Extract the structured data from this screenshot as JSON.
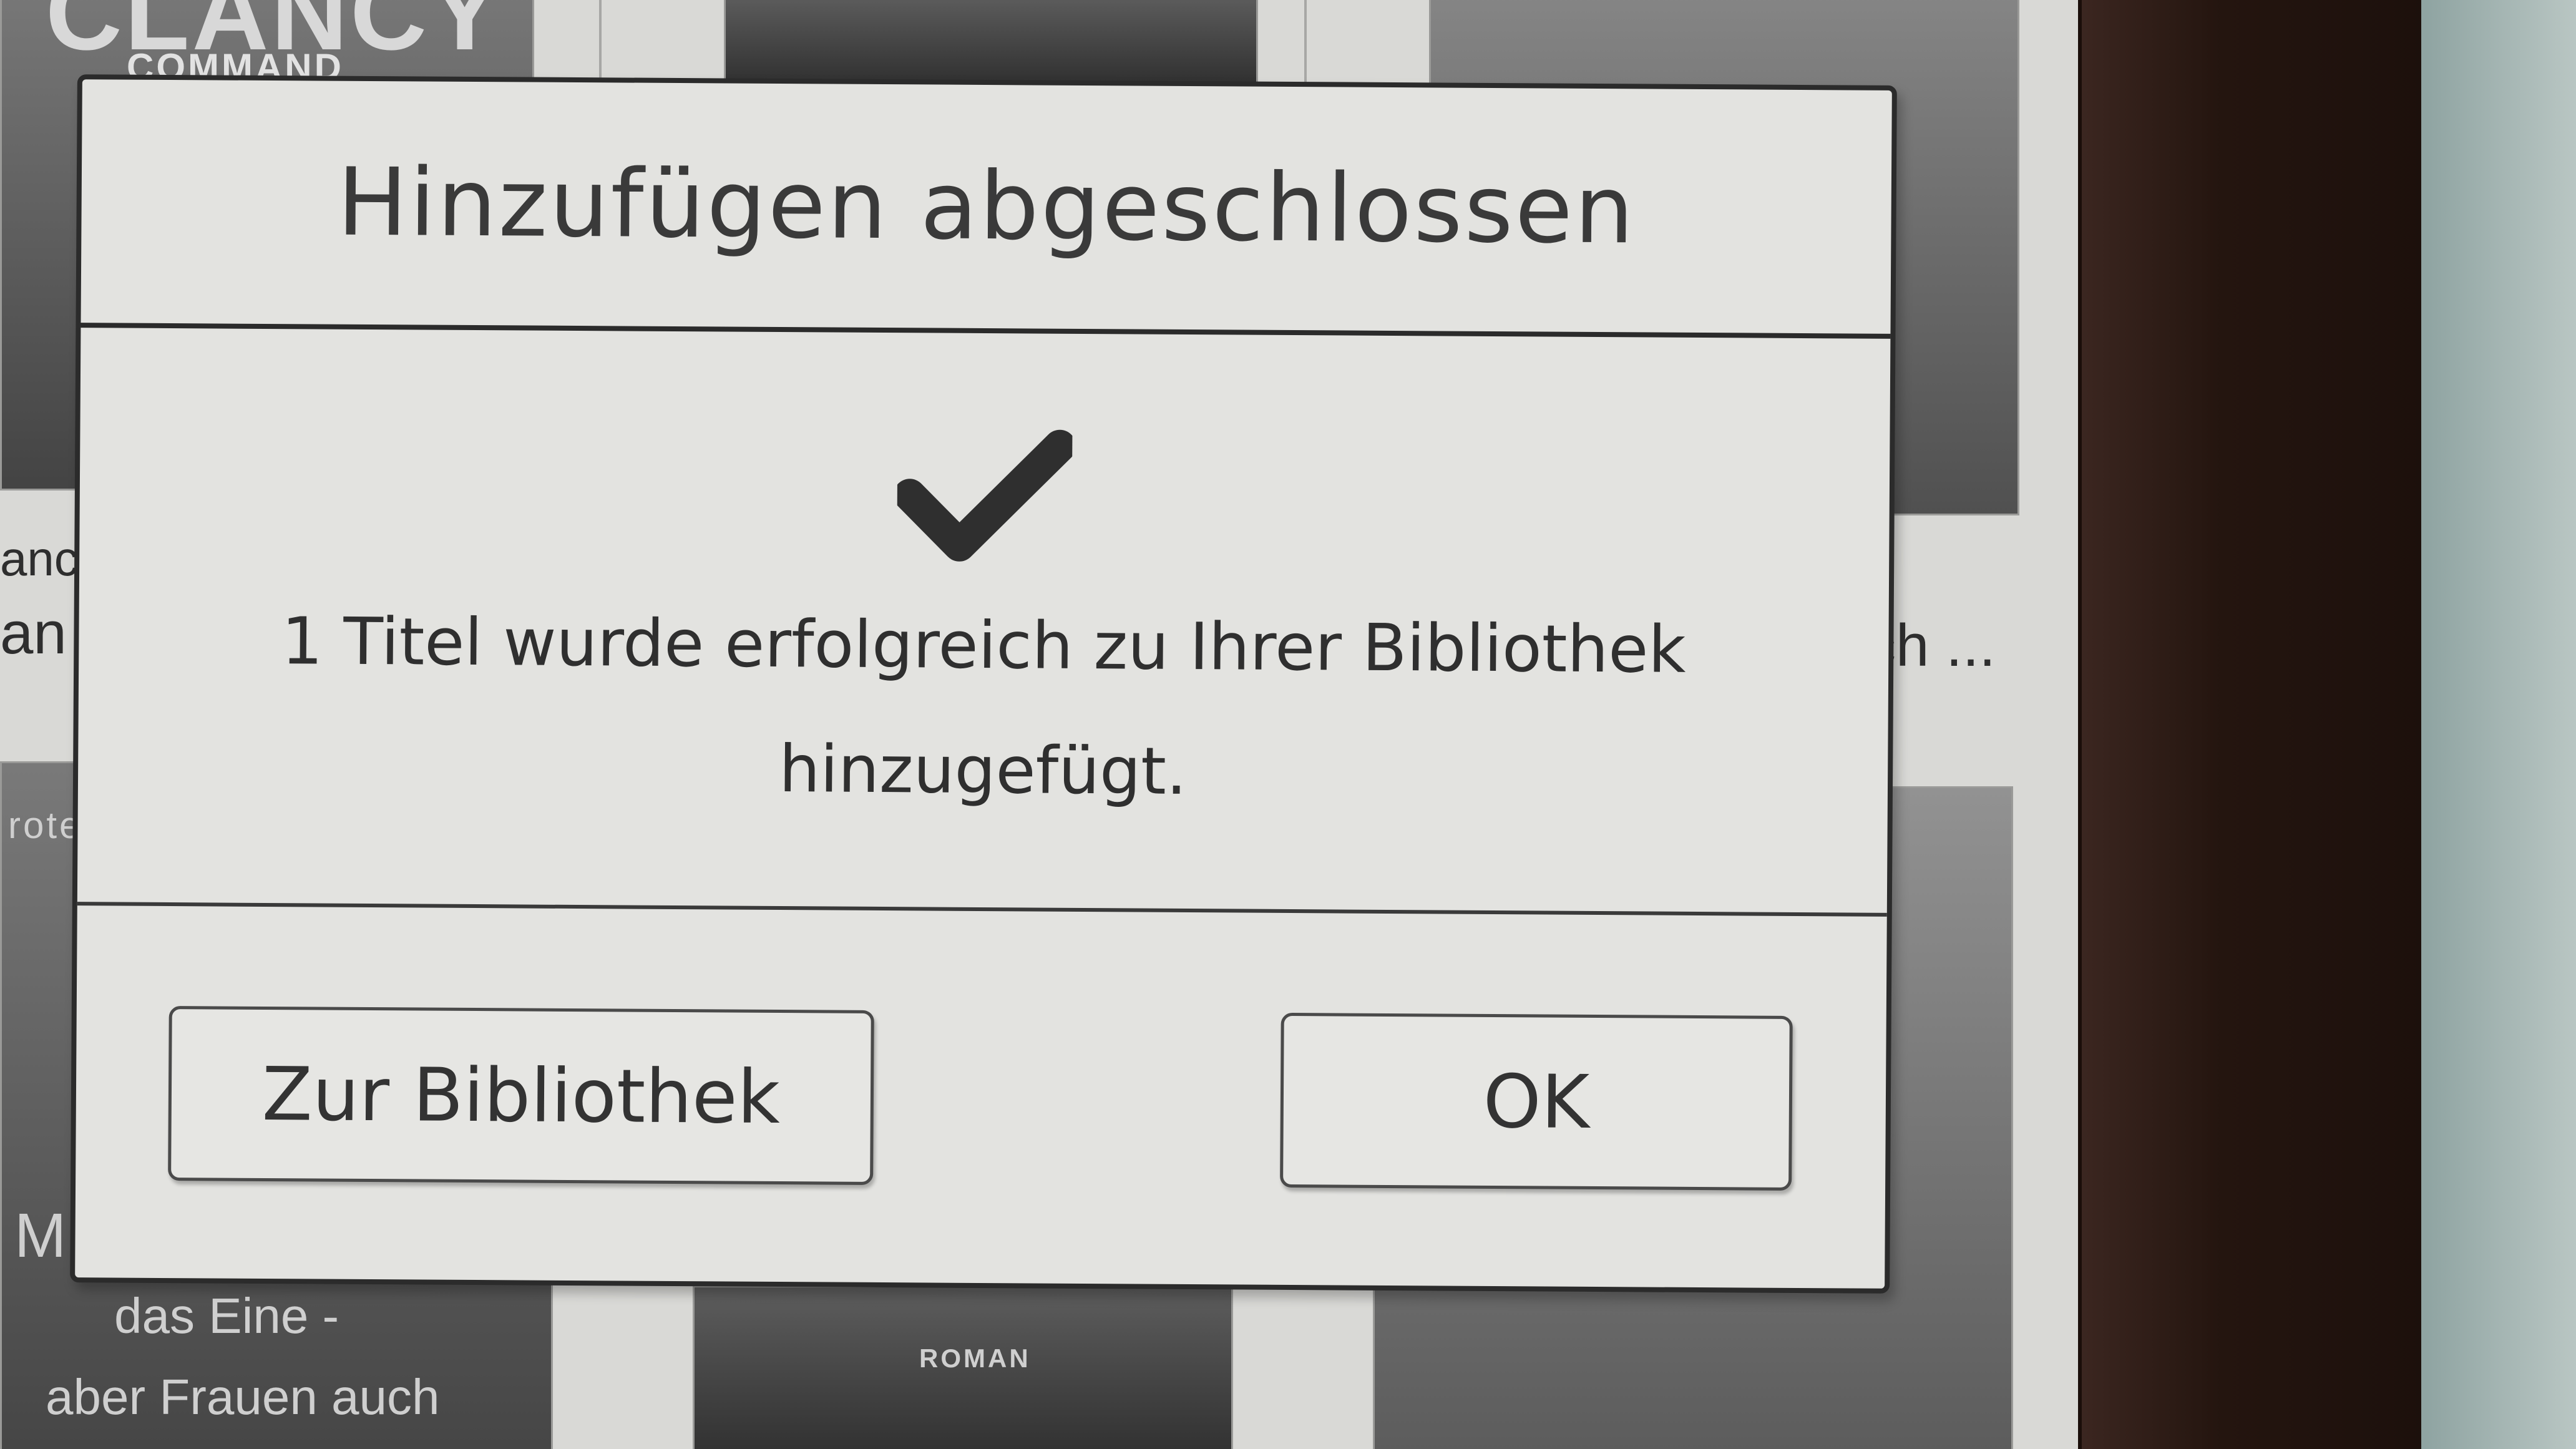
{
  "dialog": {
    "title": "Hinzufügen abgeschlossen",
    "message": "1 Titel wurde erfolgreich zu Ihrer Bibliothek hinzugefügt.",
    "buttons": {
      "library": "Zur Bibliothek",
      "ok": "OK"
    },
    "icon": "checkmark-icon"
  },
  "background": {
    "cover_top_left_title": "CLANCY",
    "cover_top_left_subtitle": "COMMAND",
    "label_left_1": "ancy",
    "label_left_2": "an",
    "label_left_3": "rote",
    "label_right_1": "ch ...",
    "label_bottom_1": "das Eine -",
    "label_bottom_2": "aber Frauen auch",
    "label_bottom_3": "M",
    "cover_bottom_mid_text": "ROMAN"
  }
}
